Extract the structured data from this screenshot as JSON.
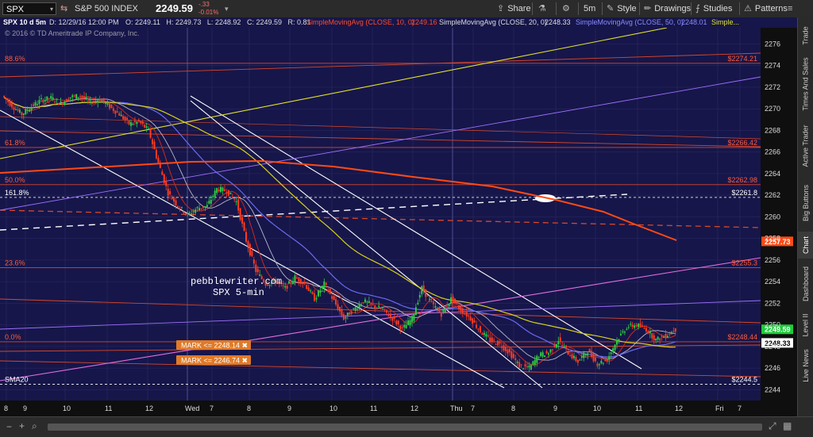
{
  "toolbar": {
    "symbol": "SPX",
    "chart_title": "SPX 10 d 5m",
    "date_time": "D: 12/29/16 12:00 PM",
    "index_name": "S&P 500 INDEX",
    "last_price": "2249.59",
    "net_change": "-.33",
    "pct_change": "-0.01%",
    "ohlc": "O: 2249.11   H: 2249.73   L: 2248.92   C: 2249.59   R: 0.81",
    "share_label": "Share",
    "timeframe_label": "5m",
    "style_label": "Style",
    "drawings_label": "Drawings",
    "studies_label": "Studies",
    "patterns_label": "Patterns"
  },
  "studies": {
    "sma10_label": "SimpleMovingAvg (CLOSE, 10, 0)",
    "sma10_value": "2249.16",
    "sma20_label": "SimpleMovingAvg (CLOSE, 20, 0)",
    "sma20_value": "2248.33",
    "sma50_label": "SimpleMovingAvg (CLOSE, 50, 0)",
    "sma50_value": "2248.01",
    "more_label": "Simple..."
  },
  "colors": {
    "chart_bg": "#16164a",
    "grid": "#2c2c66",
    "up_candle": "#2ecc40",
    "down_candle": "#ff3b1f",
    "fib_line": "#d8472a",
    "sma10": "#cc2a1a",
    "sma20": "#b7b7c8",
    "sma50": "#6a6af0",
    "sma100": "#d9d21a",
    "sma200": "#ff4a14",
    "trend_white": "#ffffff",
    "trend_yellow": "#e2e22a",
    "trend_magenta": "#e46ee0",
    "trend_purple": "#a070ff",
    "label_red": "#ff5a3a",
    "axis_text": "#dddddd",
    "last_price_badge": "#1ecb3a"
  },
  "chart_data": {
    "type": "candlestick",
    "symbol": "SPX",
    "interval": "5m",
    "ylim": [
      2243,
      2277.5
    ],
    "y_ticks": [
      2244,
      2246,
      2248,
      2250,
      2252,
      2254,
      2256,
      2258,
      2260,
      2262,
      2264,
      2266,
      2268,
      2270,
      2272,
      2274,
      2276
    ],
    "x_tick_labels": [
      "8",
      "9",
      "10",
      "11",
      "12",
      "Wed",
      "7",
      "8",
      "9",
      "10",
      "11",
      "12",
      "Thu",
      "7",
      "8",
      "9",
      "10",
      "11",
      "12",
      "Fri",
      "7"
    ],
    "fib_levels": [
      {
        "label": "88.6%",
        "value": "$2274.21",
        "price": 2274.21
      },
      {
        "label": "61.8%",
        "value": "$2266.42",
        "price": 2266.42
      },
      {
        "label": "50.0%",
        "value": "$2262.98",
        "price": 2262.98
      },
      {
        "label": "161.8%",
        "value": "$2261.8",
        "price": 2261.8
      },
      {
        "label": "23.6%",
        "value": "$2255.3",
        "price": 2255.3
      },
      {
        "label": "0.0%",
        "value": "$2248.44",
        "price": 2248.44
      }
    ],
    "sma20_level": {
      "label": "SMA20",
      "value": "$2244.5",
      "price": 2244.5
    },
    "marks": [
      {
        "text": "MARK <= 2248.14",
        "price": 2248.14
      },
      {
        "text": "MARK <= 2246.74",
        "price": 2246.74
      }
    ],
    "price_badges": [
      {
        "value": "2257.73",
        "price": 2257.73,
        "kind": "sma200"
      },
      {
        "value": "2249.59",
        "price": 2249.59,
        "kind": "last"
      },
      {
        "value": "2248.33",
        "price": 2248.33,
        "kind": "sma20"
      }
    ],
    "annotation": {
      "line1": "pebblewriter.com",
      "line2": "SPX 5-min"
    },
    "copyright": "2016 © TD Ameritrade IP Company, Inc.",
    "price_path": [
      [
        2271.5,
        2271.2
      ],
      [
        2270.8,
        2270.3
      ],
      [
        2269.8,
        2269.5
      ],
      [
        2269.6,
        2270.2
      ],
      [
        2270.4,
        2270.8
      ],
      [
        2270.6,
        2271.0
      ],
      [
        2270.8,
        2270.5
      ],
      [
        2270.6,
        2271.1
      ],
      [
        2271.4,
        2271.2
      ],
      [
        2271.0,
        2270.6
      ],
      [
        2270.4,
        2270.9
      ],
      [
        2270.6,
        2270.2
      ],
      [
        2270.0,
        2269.5
      ],
      [
        2269.4,
        2268.6
      ],
      [
        2268.4,
        2268.8
      ],
      [
        2270.2,
        2268.0
      ],
      [
        2266.8,
        2265.0
      ],
      [
        2264.2,
        2262.2
      ],
      [
        2260.4,
        2261.0
      ],
      [
        2260.8,
        2260.2
      ],
      [
        2260.0,
        2260.8
      ],
      [
        2260.6,
        2261.0
      ],
      [
        2261.4,
        2262.6
      ],
      [
        2262.8,
        2262.4
      ],
      [
        2262.5,
        2261.4
      ],
      [
        2260.0,
        2257.8
      ],
      [
        2256.5,
        2255.0
      ],
      [
        2254.8,
        2253.8
      ],
      [
        2253.6,
        2254.0
      ],
      [
        2254.2,
        2253.4
      ],
      [
        2253.6,
        2254.4
      ],
      [
        2254.2,
        2253.8
      ],
      [
        2253.6,
        2252.4
      ],
      [
        2252.8,
        2253.8
      ],
      [
        2253.4,
        2252.2
      ],
      [
        2251.8,
        2250.6
      ],
      [
        2250.8,
        2251.4
      ],
      [
        2251.6,
        2252.2
      ],
      [
        2252.4,
        2251.8
      ],
      [
        2251.6,
        2251.4
      ],
      [
        2251.2,
        2250.6
      ],
      [
        2250.4,
        2249.6
      ],
      [
        2249.8,
        2250.6
      ],
      [
        2251.4,
        2253.4
      ],
      [
        2253.0,
        2252.0
      ],
      [
        2251.8,
        2251.0
      ],
      [
        2251.6,
        2252.4
      ],
      [
        2252.4,
        2251.4
      ],
      [
        2251.4,
        2250.6
      ],
      [
        2250.4,
        2249.4
      ],
      [
        2249.2,
        2248.6
      ],
      [
        2248.6,
        2248.2
      ],
      [
        2248.0,
        2247.4
      ],
      [
        2247.2,
        2246.2
      ],
      [
        2246.4,
        2246.0
      ],
      [
        2246.4,
        2247.2
      ],
      [
        2247.2,
        2247.4
      ],
      [
        2247.6,
        2248.6
      ],
      [
        2248.4,
        2247.4
      ],
      [
        2247.2,
        2246.6
      ],
      [
        2246.8,
        2247.6
      ],
      [
        2247.2,
        2246.4
      ],
      [
        2246.4,
        2246.8
      ],
      [
        2247.2,
        2248.6
      ],
      [
        2248.8,
        2249.8
      ],
      [
        2249.8,
        2250.0
      ],
      [
        2250.2,
        2249.6
      ],
      [
        2249.4,
        2248.6
      ],
      [
        2248.8,
        2249.0
      ],
      [
        2249.2,
        2249.59
      ]
    ]
  },
  "sidebar": {
    "tabs": [
      "Trade",
      "Times And Sales",
      "Active Trader",
      "Big Buttons",
      "Chart",
      "Dashboard",
      "Level II",
      "Live News"
    ]
  }
}
